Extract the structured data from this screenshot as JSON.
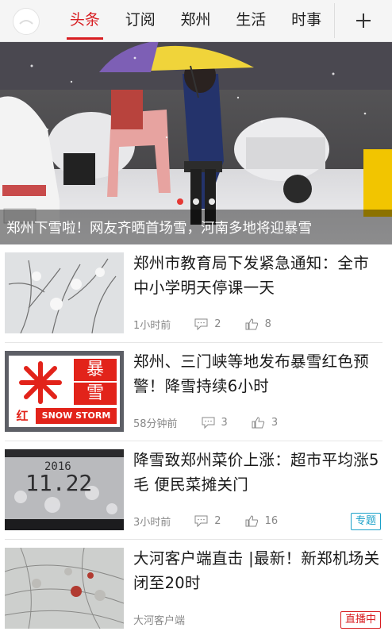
{
  "nav": {
    "tabs": [
      {
        "label": "头条",
        "active": true
      },
      {
        "label": "订阅",
        "active": false
      },
      {
        "label": "郑州",
        "active": false
      },
      {
        "label": "生活",
        "active": false
      },
      {
        "label": "时事",
        "active": false
      }
    ],
    "add_icon": "plus-icon",
    "accent_color": "#d81e22"
  },
  "hero": {
    "caption": "郑州下雪啦！网友齐晒首场雪，河南多地将迎暴雪",
    "slide_count": 3,
    "active_slide": 1
  },
  "news": [
    {
      "title": "郑州市教育局下发紧急通知：全市中小学明天停课一天",
      "time": "1小时前",
      "comments": "2",
      "likes": "8",
      "tag": ""
    },
    {
      "title": "郑州、三门峡等地发布暴雪红色预警！降雪持续6小时",
      "time": "58分钟前",
      "comments": "3",
      "likes": "3",
      "tag": "",
      "thumb_text": {
        "big1": "暴",
        "big2": "雪",
        "small": "红",
        "en": "SNOW STORM"
      }
    },
    {
      "title": "降雪致郑州菜价上涨：超市平均涨5毛 便民菜摊关门",
      "time": "3小时前",
      "comments": "2",
      "likes": "16",
      "tag": "专题",
      "thumb_text": {
        "line1": "2016",
        "line2": "11.22"
      }
    },
    {
      "title": "大河客户端直击 |最新！新郑机场关闭至20时",
      "source": "大河客户端",
      "tag": "直播中"
    }
  ]
}
